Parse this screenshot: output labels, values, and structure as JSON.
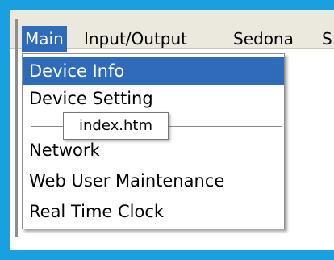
{
  "menubar": {
    "items": [
      {
        "label": "Main",
        "active": true
      },
      {
        "label": "Input/Output",
        "active": false
      },
      {
        "label": "Sedona",
        "active": false
      },
      {
        "label": "S",
        "active": false
      }
    ]
  },
  "dropdown": {
    "items": [
      {
        "label": "Device Info",
        "selected": true
      },
      {
        "label": "Device Setting",
        "selected": false
      },
      {
        "label": "Network",
        "selected": false
      },
      {
        "label": "Web User Maintenance",
        "selected": false
      },
      {
        "label": "Real Time Clock",
        "selected": false
      }
    ]
  },
  "tooltip": {
    "text": "index.htm"
  },
  "colors": {
    "frame": "#1aa0e0",
    "menubar_bg": "#ebe9dd",
    "highlight": "#2f6bb8"
  }
}
